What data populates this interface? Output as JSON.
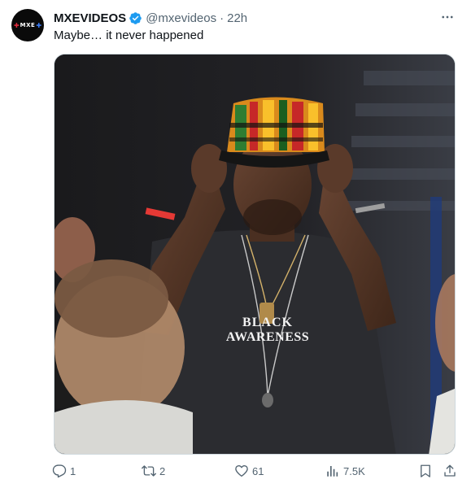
{
  "tweet": {
    "avatar": {
      "logo_text": "MXE"
    },
    "display_name": "MXEVIDEOS",
    "verified": true,
    "handle": "@mxevideos",
    "separator": "·",
    "time": "22h",
    "text": "Maybe… it never happened",
    "image": {
      "shirt_text_line1": "BLACK",
      "shirt_text_line2": "AWARENESS"
    },
    "actions": {
      "reply_count": "1",
      "retweet_count": "2",
      "like_count": "61",
      "views_count": "7.5K"
    }
  },
  "colors": {
    "text_primary": "#0f1419",
    "text_secondary": "#536471",
    "verified_blue": "#1d9bf0"
  },
  "icons": [
    "more-icon",
    "verified-badge-icon",
    "reply-icon",
    "retweet-icon",
    "like-icon",
    "views-icon",
    "bookmark-icon",
    "share-icon"
  ]
}
